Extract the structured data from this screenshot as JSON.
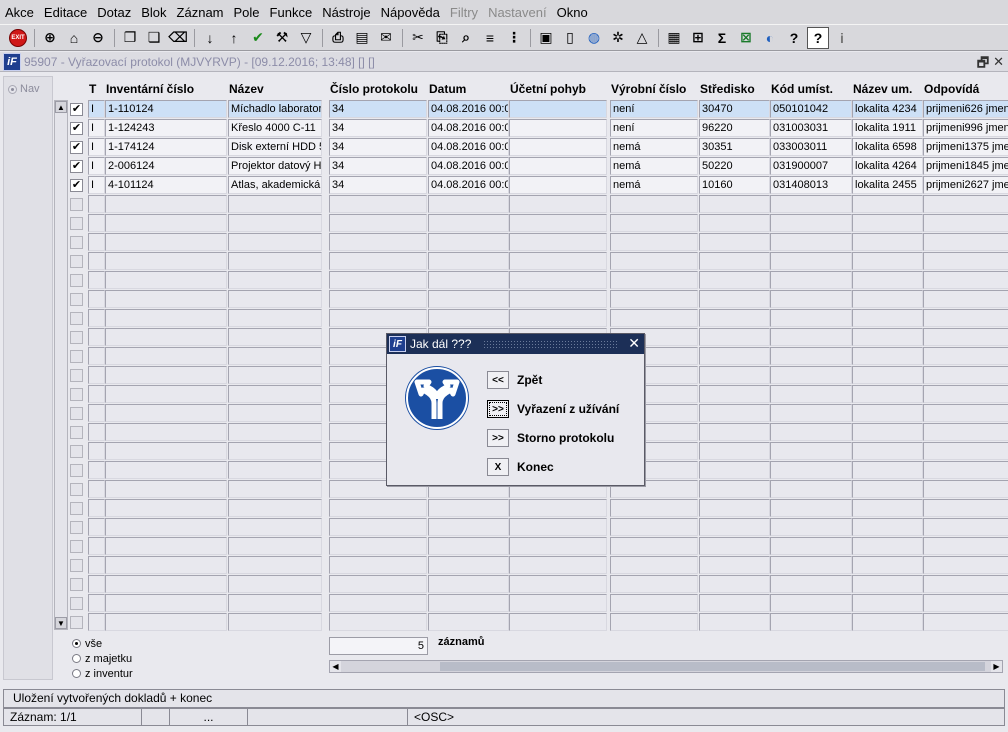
{
  "menu": [
    {
      "label": "Akce"
    },
    {
      "label": "Editace"
    },
    {
      "label": "Dotaz"
    },
    {
      "label": "Blok"
    },
    {
      "label": "Záznam"
    },
    {
      "label": "Pole"
    },
    {
      "label": "Funkce"
    },
    {
      "label": "Nástroje"
    },
    {
      "label": "Nápověda"
    },
    {
      "label": "Filtry",
      "disabled": true
    },
    {
      "label": "Nastavení",
      "disabled": true
    },
    {
      "label": "Okno"
    }
  ],
  "toolbar": {
    "exit_label": "EXIT",
    "icons": [
      "exit-icon",
      "sep",
      "insert-record-icon",
      "home-record-icon",
      "delete-record-icon",
      "sep",
      "copy-icon",
      "copy-all-icon",
      "clear-icon",
      "sep",
      "sort-asc-icon",
      "sort-desc-icon",
      "confirm-icon",
      "tools-icon",
      "filter-icon",
      "sep",
      "print-icon",
      "print-preview-icon",
      "mail-icon",
      "sep",
      "cut-icon",
      "paste-icon",
      "find-icon",
      "list-icon",
      "tree-icon",
      "sep",
      "clipboard-icon",
      "document-icon",
      "globe-icon",
      "settings-icon",
      "map-icon",
      "sep",
      "chart-icon",
      "query-icon",
      "sum-icon",
      "excel-icon",
      "web-icon",
      "help-icon",
      "context-help-icon",
      "info-icon"
    ]
  },
  "window": {
    "title": "95907 - Vyřazovací protokol (MJVYRVP) - [09.12.2016; 13:48]  []  []",
    "logo": "iF"
  },
  "nav": {
    "label": "Nav"
  },
  "grid": {
    "headers": {
      "t": "T",
      "inv_cislo": "Inventární číslo",
      "nazev": "Název",
      "cislo_protokolu": "Číslo protokolu",
      "datum": "Datum",
      "ucetni_pohyb": "Účetní pohyb",
      "vyrobni_cislo": "Výrobní číslo",
      "stredisko": "Středisko",
      "kod_umist": "Kód umíst.",
      "nazev_um": "Název um.",
      "odpovida": "Odpovídá"
    },
    "rows": [
      {
        "checked": true,
        "t": "I",
        "inv_cislo": "1-110124",
        "nazev": "Míchadlo laborator",
        "cislo_protokolu": "34",
        "datum": "04.08.2016 00:0",
        "ucetni_pohyb": "",
        "vyrobni_cislo": "není",
        "stredisko": "30470",
        "kod_umist": "050101042",
        "nazev_um": "lokalita 4234",
        "odpovida": "prijmeni626 jmen"
      },
      {
        "checked": true,
        "t": "I",
        "inv_cislo": "1-124243",
        "nazev": "Křeslo 4000 C-11",
        "cislo_protokolu": "34",
        "datum": "04.08.2016 00:0",
        "ucetni_pohyb": "",
        "vyrobni_cislo": "není",
        "stredisko": "96220",
        "kod_umist": "031003031",
        "nazev_um": "lokalita 1911",
        "odpovida": "prijmeni996 jmen"
      },
      {
        "checked": true,
        "t": "I",
        "inv_cislo": "1-174124",
        "nazev": "Disk externí HDD 5",
        "cislo_protokolu": "34",
        "datum": "04.08.2016 00:0",
        "ucetni_pohyb": "",
        "vyrobni_cislo": "nemá",
        "stredisko": "30351",
        "kod_umist": "033003011",
        "nazev_um": "lokalita 6598",
        "odpovida": "prijmeni1375 jme"
      },
      {
        "checked": true,
        "t": "I",
        "inv_cislo": "2-006124",
        "nazev": "Projektor datový H",
        "cislo_protokolu": "34",
        "datum": "04.08.2016 00:0",
        "ucetni_pohyb": "",
        "vyrobni_cislo": "nemá",
        "stredisko": "50220",
        "kod_umist": "031900007",
        "nazev_um": "lokalita 4264",
        "odpovida": "prijmeni1845 jme"
      },
      {
        "checked": true,
        "t": "I",
        "inv_cislo": "4-101124",
        "nazev": "Atlas, akademická",
        "cislo_protokolu": "34",
        "datum": "04.08.2016 00:0",
        "ucetni_pohyb": "",
        "vyrobni_cislo": "nemá",
        "stredisko": "10160",
        "kod_umist": "031408013",
        "nazev_um": "lokalita 2455",
        "odpovida": "prijmeni2627 jme"
      }
    ],
    "empty_rows": 23
  },
  "filter": {
    "options": [
      {
        "label": "vše",
        "selected": true
      },
      {
        "label": "z majetku",
        "selected": false
      },
      {
        "label": "z inventur",
        "selected": false
      }
    ]
  },
  "count": {
    "value": "5",
    "label": "záznamů"
  },
  "hint": "Uložení vytvořených dokladů + konec",
  "status": {
    "record": "Záznam: 1/1",
    "ellipsis": "...",
    "mode": "<OSC>"
  },
  "dialog": {
    "title": "Jak dál ???",
    "logo": "iF",
    "buttons": [
      {
        "key": "<<",
        "label": "Zpět"
      },
      {
        "key": ">>",
        "label": "Vyřazení z užívání",
        "focused": true
      },
      {
        "key": ">>",
        "label": "Storno protokolu"
      },
      {
        "key": "X",
        "label": "Konec"
      }
    ]
  }
}
